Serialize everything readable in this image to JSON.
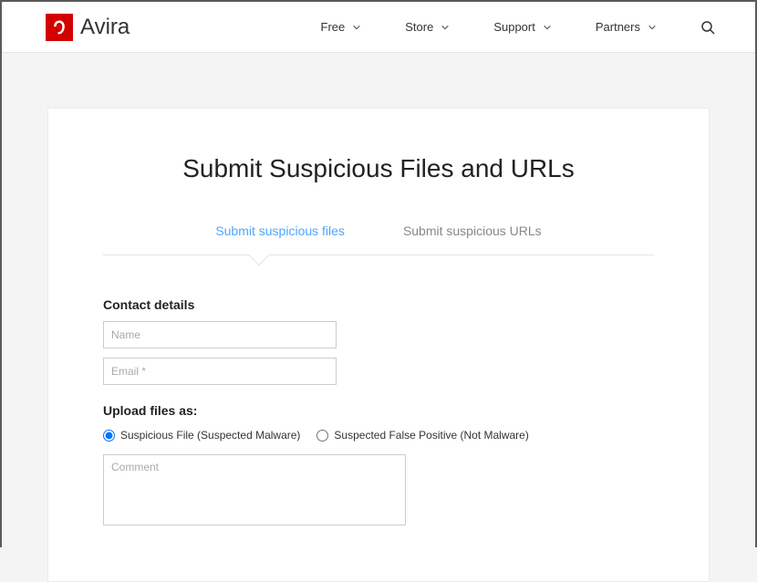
{
  "brand": "Avira",
  "nav": {
    "items": [
      {
        "label": "Free"
      },
      {
        "label": "Store"
      },
      {
        "label": "Support"
      },
      {
        "label": "Partners"
      }
    ]
  },
  "page": {
    "title": "Submit Suspicious Files and URLs"
  },
  "tabs": {
    "files": "Submit suspicious files",
    "urls": "Submit suspicious URLs"
  },
  "form": {
    "contact_heading": "Contact details",
    "name_placeholder": "Name",
    "email_placeholder": "Email *",
    "upload_heading": "Upload files as:",
    "radio_suspicious": "Suspicious File (Suspected Malware)",
    "radio_falsepos": "Suspected False Positive (Not Malware)",
    "comment_placeholder": "Comment"
  }
}
